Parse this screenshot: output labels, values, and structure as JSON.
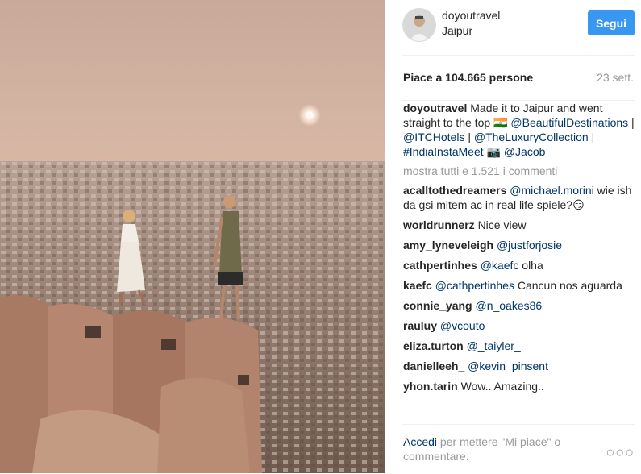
{
  "header": {
    "username": "doyoutravel",
    "location": "Jaipur",
    "follow_label": "Segui"
  },
  "stats": {
    "likes_text": "Piace a 104.665 persone",
    "date": "23 sett."
  },
  "caption": {
    "username": "doyoutravel",
    "text1": "Made it to Jaipur and went straight to the top ",
    "emoji_moon": "🇮🇳",
    "mention1": "@BeautifulDestinations",
    "sep1": " | ",
    "mention2": "@ITCHotels",
    "sep2": " | ",
    "mention3": "@TheLuxuryCollection",
    "sep3": " | ",
    "mention4": "#IndiaInstaMeet",
    "camera": "📷",
    "mention5": "@Jacob"
  },
  "show_all": "mostra tutti e 1.521 i commenti",
  "comments": [
    {
      "user": "acalltothedreamers",
      "mention": "@michael.morini",
      "text": " wie ish da gsi mitem ac in real life spiele?😏"
    },
    {
      "user": "worldrunnerz",
      "mention": "",
      "text": "Nice view"
    },
    {
      "user": "amy_lyneveleigh",
      "mention": "@justforjosie",
      "text": ""
    },
    {
      "user": "cathpertinhes",
      "mention": "@kaefc",
      "text": " olha"
    },
    {
      "user": "kaefc",
      "mention": "@cathpertinhes",
      "text": " Cancun nos aguarda"
    },
    {
      "user": "connie_yang",
      "mention": "@n_oakes86",
      "text": ""
    },
    {
      "user": "rauluy",
      "mention": "@vcouto",
      "text": ""
    },
    {
      "user": "eliza.turton",
      "mention": "@_taiyler_",
      "text": ""
    },
    {
      "user": "danielleeh_",
      "mention": "@kevin_pinsent",
      "text": ""
    },
    {
      "user": "yhon.tarin",
      "mention": "",
      "text": "Wow.. Amazing.."
    }
  ],
  "footer": {
    "login_label": "Accedi",
    "rest": " per mettere \"Mi piace\" o commentare.",
    "more_icon": "more-options-icon",
    "more_glyph": "○○○"
  },
  "colors": {
    "follow_bg": "#3897f0",
    "link": "#003569",
    "muted": "#999999"
  }
}
